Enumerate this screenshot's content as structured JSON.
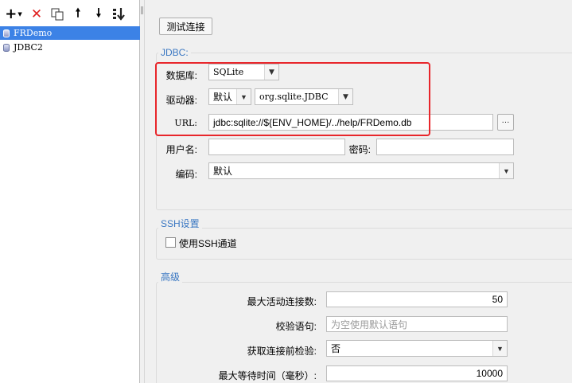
{
  "toolbar": {
    "add_icon": "plus-dropdown-icon",
    "delete_icon": "red-x-icon",
    "copy_icon": "copy-icon",
    "up_icon": "arrow-up-icon",
    "down_icon": "arrow-down-icon",
    "sort_icon": "sort-icon",
    "colors": {
      "delete": "#e02020"
    }
  },
  "tree": {
    "items": [
      {
        "label": "FRDemo",
        "selected": true
      },
      {
        "label": "JDBC2",
        "selected": false
      }
    ]
  },
  "colors": {
    "selection": "#3c82e6",
    "accent": "#3a77c2",
    "highlight": "#e8262b"
  },
  "test_button": "测试连接",
  "jdbc": {
    "legend": "JDBC:",
    "database_label": "数据库:",
    "database_value": "SQLite",
    "driver_label": "驱动器:",
    "driver_mode": "默认",
    "driver_value": "org.sqlite.JDBC",
    "url_label": "URL:",
    "url_value": "jdbc:sqlite://${ENV_HOME}/../help/FRDemo.db",
    "url_button": "···",
    "username_label": "用户名:",
    "username_value": "",
    "password_label": "密码:",
    "password_value": "",
    "encoding_label": "编码:",
    "encoding_value": "默认"
  },
  "ssh": {
    "legend": "SSH设置",
    "checkbox_label": "使用SSH通道",
    "checked": false
  },
  "advanced": {
    "legend": "高级",
    "max_active_label": "最大活动连接数:",
    "max_active_value": "50",
    "validation_query_label": "校验语句:",
    "validation_query_placeholder": "为空使用默认语句",
    "test_on_borrow_label": "获取连接前检验:",
    "test_on_borrow_value": "否",
    "max_wait_label": "最大等待时间（毫秒）:",
    "max_wait_value": "10000"
  }
}
